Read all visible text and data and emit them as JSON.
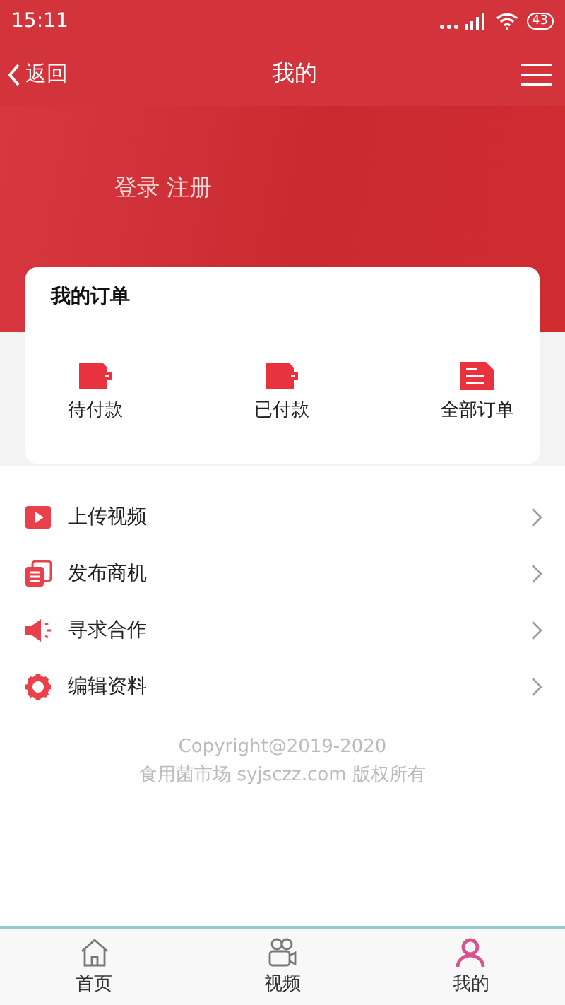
{
  "status_bar": {
    "time": "15:11",
    "battery": "43"
  },
  "nav": {
    "back": "返回",
    "title": "我的"
  },
  "hero": {
    "login": "登录 注册"
  },
  "orders": {
    "title": "我的订单",
    "items": [
      {
        "kind": "wallet",
        "label": "待付款"
      },
      {
        "kind": "wallet",
        "label": "已付款"
      },
      {
        "kind": "document",
        "label": "全部订单"
      }
    ]
  },
  "menu": [
    {
      "kind": "video",
      "label": "上传视频"
    },
    {
      "kind": "pages",
      "label": "发布商机"
    },
    {
      "kind": "speaker",
      "label": "寻求合作"
    },
    {
      "kind": "gear",
      "label": "编辑资料"
    }
  ],
  "footer": [
    "Copyright@2019-2020",
    "食用菌市场 syjsczz.com 版权所有"
  ],
  "tabs": [
    {
      "kind": "home",
      "label": "首页",
      "selected": false
    },
    {
      "kind": "camera",
      "label": "视频",
      "selected": false
    },
    {
      "kind": "person",
      "label": "我的",
      "selected": true
    }
  ]
}
